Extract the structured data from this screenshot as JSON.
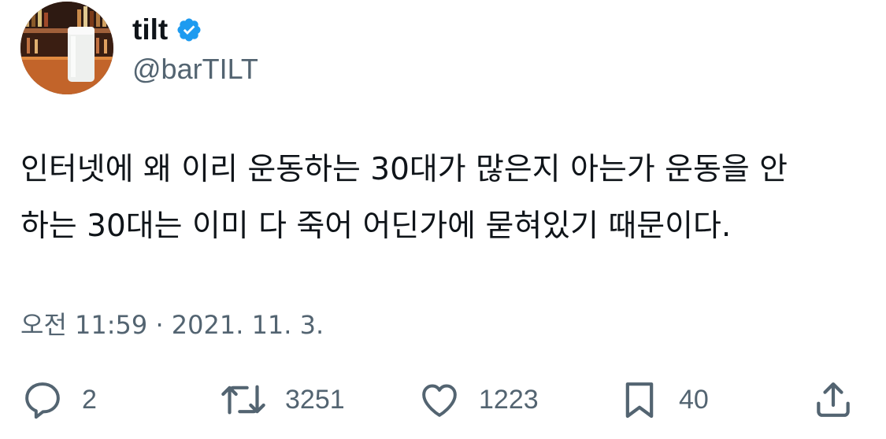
{
  "author": {
    "display_name": "tilt",
    "handle": "@barTILT",
    "verified": true,
    "avatar_icon": "bar-glass-avatar"
  },
  "tweet": {
    "lines": [
      "인터넷에 왜 이리 운동하는 30대가 많은지 아는가 운동을 안",
      "하는 30대는 이미 다 죽어 어딘가에 묻혀있기 때문이다."
    ],
    "timestamp": "오전 11:59 · 2021. 11. 3."
  },
  "actions": {
    "reply": {
      "icon": "reply-icon",
      "count": "2"
    },
    "retweet": {
      "icon": "retweet-icon",
      "count": "3251"
    },
    "like": {
      "icon": "heart-icon",
      "count": "1223"
    },
    "bookmark": {
      "icon": "bookmark-icon",
      "count": "40"
    },
    "share": {
      "icon": "share-icon"
    }
  },
  "colors": {
    "text": "#0f1419",
    "secondary": "#536471",
    "verified_blue": "#1d9bf0",
    "background": "#ffffff"
  }
}
